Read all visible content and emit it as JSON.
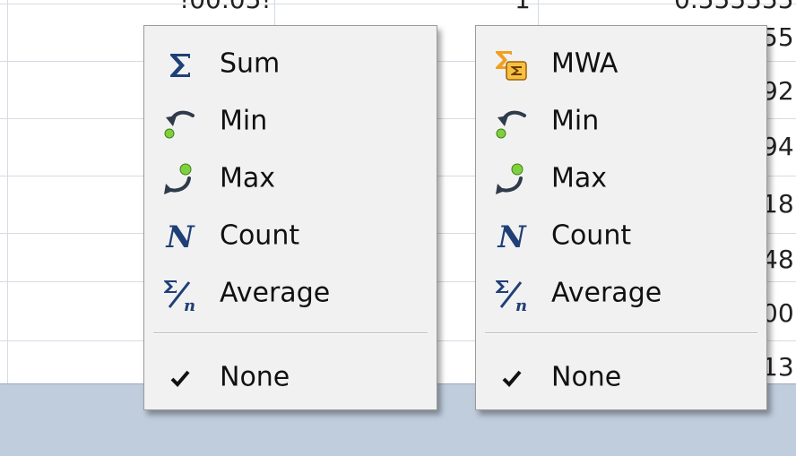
{
  "grid": {
    "col_top_partial": [
      "!00.05!",
      "1",
      "0.555555"
    ],
    "right_col_partial_values": [
      "55",
      "92",
      "94",
      "18",
      "48",
      "00",
      "13"
    ]
  },
  "menus": [
    {
      "name": "aggregate-menu-left",
      "items": [
        {
          "icon": "sigma-icon",
          "label": "Sum"
        },
        {
          "icon": "min-icon",
          "label": "Min"
        },
        {
          "icon": "max-icon",
          "label": "Max"
        },
        {
          "icon": "count-n-icon",
          "label": "Count"
        },
        {
          "icon": "average-icon",
          "label": "Average"
        }
      ],
      "none": {
        "icon": "checkmark-icon",
        "label": "None"
      }
    },
    {
      "name": "aggregate-menu-right",
      "items": [
        {
          "icon": "mwa-icon",
          "label": "MWA"
        },
        {
          "icon": "min-icon",
          "label": "Min"
        },
        {
          "icon": "max-icon",
          "label": "Max"
        },
        {
          "icon": "count-n-icon",
          "label": "Count"
        },
        {
          "icon": "average-icon",
          "label": "Average"
        }
      ],
      "none": {
        "icon": "checkmark-icon",
        "label": "None"
      }
    }
  ],
  "colors": {
    "icon_blue": "#1f3f77",
    "arrow_dark": "#2f3b4a",
    "green_dot": "#7fd13b",
    "mwa_orange": "#f0a020",
    "footer": "#bfcddc"
  }
}
